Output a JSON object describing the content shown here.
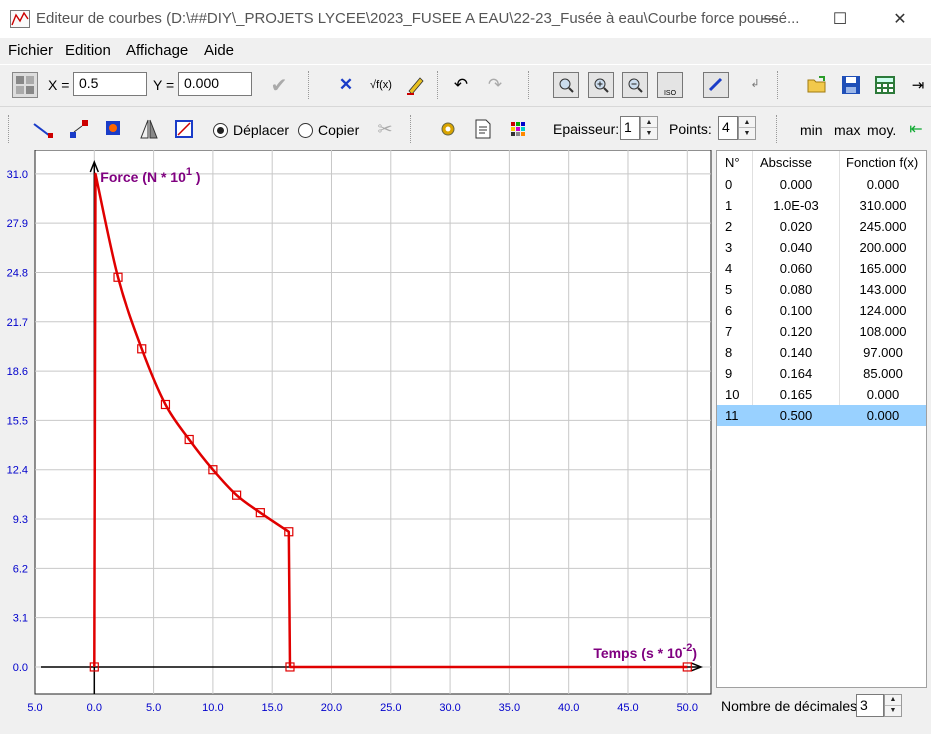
{
  "window": {
    "title": "Editeur de courbes (D:\\##DIY\\_PROJETS LYCEE\\2023_FUSEE A EAU\\22-23_Fusée à eau\\Courbe force poussé...",
    "minimize": "—",
    "maximize": "☐",
    "close": "✕"
  },
  "menu": [
    "Fichier",
    "Edition",
    "Affichage",
    "Aide"
  ],
  "coords": {
    "x_label": "X =",
    "x_value": "0.5",
    "y_label": "Y =",
    "y_value": "0.000"
  },
  "mode": {
    "move_label": "Déplacer",
    "copy_label": "Copier",
    "selected": "move"
  },
  "thickness": {
    "label": "Epaisseur:",
    "value": "1"
  },
  "points": {
    "label": "Points:",
    "value": "4"
  },
  "stats": {
    "min": "min",
    "max": "max",
    "moy": "moy."
  },
  "chart_data": {
    "type": "line",
    "title": "",
    "ylabel": "Force (N * 10",
    "ylabel_exp": "1",
    "ylabel_close": " )",
    "xlabel": "Temps (s * 10",
    "xlabel_exp": "-2",
    "xlabel_close": ")",
    "xlim": [
      -5,
      52
    ],
    "ylim": [
      -1.7,
      32.5
    ],
    "xticks": [
      -5.0,
      0.0,
      5.0,
      10.0,
      15.0,
      20.0,
      25.0,
      30.0,
      35.0,
      40.0,
      45.0,
      50.0
    ],
    "xtick_labels": [
      "5.0",
      "0.0",
      "5.0",
      "10.0",
      "15.0",
      "20.0",
      "25.0",
      "30.0",
      "35.0",
      "40.0",
      "45.0",
      "50.0"
    ],
    "yticks": [
      0.0,
      3.1,
      6.2,
      9.3,
      12.4,
      15.5,
      18.6,
      21.7,
      24.8,
      27.9,
      31.0
    ],
    "ytick_labels": [
      "0.0",
      "3.1",
      "6.2",
      "9.3",
      "12.4",
      "15.5",
      "18.6",
      "21.7",
      "24.8",
      "27.9",
      "31.0"
    ],
    "grid": true,
    "series": [
      {
        "name": "",
        "color": "#e00000",
        "x": [
          0.0,
          0.1,
          2.0,
          4.0,
          6.0,
          8.0,
          10.0,
          12.0,
          14.0,
          16.4,
          16.5,
          50.0
        ],
        "y": [
          0.0,
          31.0,
          24.5,
          20.0,
          16.5,
          14.3,
          12.4,
          10.8,
          9.7,
          8.5,
          0.0,
          0.0
        ]
      }
    ],
    "colors": {
      "axis_text": "#0000cc",
      "axis_title": "#800080",
      "curve": "#e00000",
      "grid": "#c8c8c8"
    }
  },
  "table": {
    "headers": [
      "N°",
      "Abscisse",
      "Fonction f(x)"
    ],
    "rows": [
      [
        "0",
        "0.000",
        "0.000"
      ],
      [
        "1",
        "1.0E-03",
        "310.000"
      ],
      [
        "2",
        "0.020",
        "245.000"
      ],
      [
        "3",
        "0.040",
        "200.000"
      ],
      [
        "4",
        "0.060",
        "165.000"
      ],
      [
        "5",
        "0.080",
        "143.000"
      ],
      [
        "6",
        "0.100",
        "124.000"
      ],
      [
        "7",
        "0.120",
        "108.000"
      ],
      [
        "8",
        "0.140",
        "97.000"
      ],
      [
        "9",
        "0.164",
        "85.000"
      ],
      [
        "10",
        "0.165",
        "0.000"
      ],
      [
        "11",
        "0.500",
        "0.000"
      ]
    ],
    "selected_row": 11
  },
  "decimals": {
    "label": "Nombre de décimales",
    "value": "3"
  },
  "icons": {
    "sqrt": "√f(x)",
    "iso": "ISO"
  }
}
